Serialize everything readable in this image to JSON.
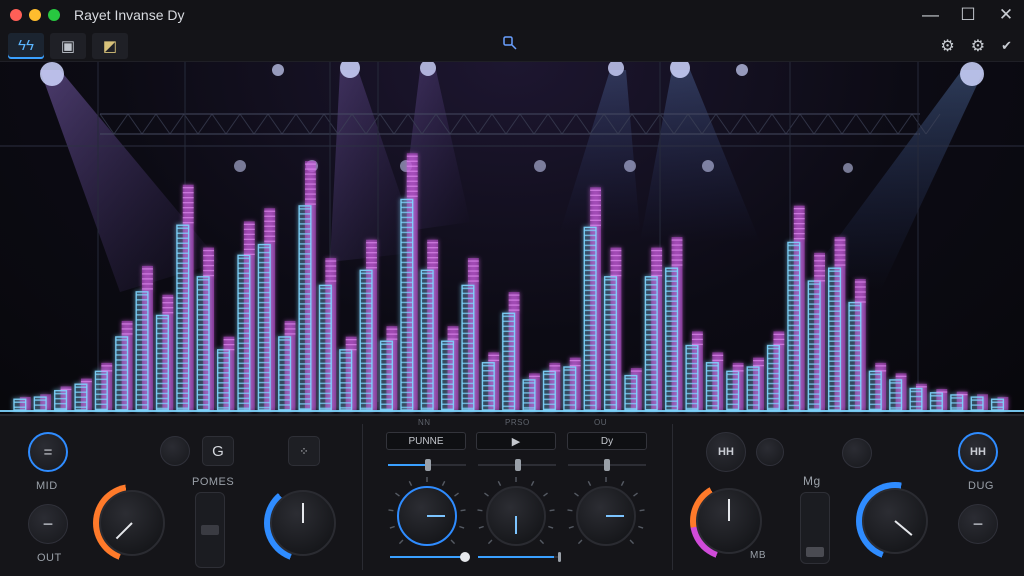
{
  "window": {
    "title": "Rayet Invanse Dy",
    "controls": {
      "minimize": "—",
      "maximize": "☐",
      "close": "✕"
    }
  },
  "toolbar": {
    "items": [
      {
        "icon": "waveform-icon",
        "glyph": "ϟϟ",
        "active": true
      },
      {
        "icon": "save-icon",
        "glyph": "▣",
        "active": false
      },
      {
        "icon": "image-icon",
        "glyph": "◩",
        "active": false
      }
    ],
    "center_icon": "search-icon",
    "right_icons": [
      "settings-icon",
      "settings-icon",
      "pin-icon"
    ]
  },
  "visualizer": {
    "bar_levels": [
      0.05,
      0.06,
      0.09,
      0.12,
      0.18,
      0.34,
      0.55,
      0.44,
      0.86,
      0.62,
      0.28,
      0.72,
      0.77,
      0.34,
      0.95,
      0.58,
      0.28,
      0.65,
      0.32,
      0.98,
      0.65,
      0.32,
      0.58,
      0.22,
      0.45,
      0.14,
      0.18,
      0.2,
      0.85,
      0.62,
      0.16,
      0.62,
      0.66,
      0.3,
      0.22,
      0.18,
      0.2,
      0.3,
      0.78,
      0.6,
      0.66,
      0.5,
      0.18,
      0.14,
      0.1,
      0.08,
      0.07,
      0.06,
      0.05
    ],
    "colors": {
      "cyan": "#7fd6ff",
      "magenta": "#b94fcf"
    }
  },
  "deck": {
    "left": {
      "label_mid": "MID",
      "label_out": "OUT",
      "label_pomes": "POMES",
      "button_g": "G",
      "button_eq": "=",
      "button_minus": "−",
      "button_sq": "⁘"
    },
    "center": {
      "pill_1": "PUNNE",
      "pill_2": "▶",
      "pill_3": "Dy",
      "tiny_1": "NN",
      "tiny_2": "PRSO",
      "tiny_3": "OU"
    },
    "right": {
      "label_mg": "Mg",
      "label_mb": "MB",
      "label_dug": "DUG",
      "button_hh_1": "HH",
      "button_hh_2": "HH",
      "button_minus": "−"
    },
    "accents": {
      "orange": "#ff7a2a",
      "blue": "#2f8cff",
      "magenta": "#d04bd9"
    }
  }
}
